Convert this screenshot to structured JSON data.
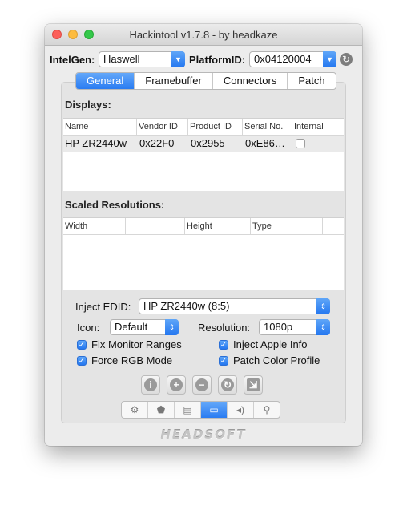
{
  "window": {
    "title": "Hackintool v1.7.8 - by headkaze"
  },
  "top": {
    "intelgen_label": "IntelGen:",
    "intelgen_value": "Haswell",
    "platformid_label": "PlatformID:",
    "platformid_value": "0x04120004"
  },
  "tabs": [
    "General",
    "Framebuffer",
    "Connectors",
    "Patch"
  ],
  "displays": {
    "heading": "Displays:",
    "columns": [
      "Name",
      "Vendor ID",
      "Product ID",
      "Serial No.",
      "Internal"
    ],
    "rows": [
      {
        "name": "HP ZR2440w",
        "vendor_id": "0x22F0",
        "product_id": "0x2955",
        "serial": "0xE86…",
        "internal": false
      }
    ]
  },
  "scaled": {
    "heading": "Scaled Resolutions:",
    "columns": [
      "Width",
      "",
      "Height",
      "Type"
    ]
  },
  "settings": {
    "inject_edid_label": "Inject EDID:",
    "inject_edid_value": "HP ZR2440w (8:5)",
    "icon_label": "Icon:",
    "icon_value": "Default",
    "resolution_label": "Resolution:",
    "resolution_value": "1080p",
    "fix_monitor_ranges": "Fix Monitor Ranges",
    "inject_apple_info": "Inject Apple Info",
    "force_rgb_mode": "Force RGB Mode",
    "patch_color_profile": "Patch Color Profile"
  },
  "actions": [
    "info-icon",
    "add-icon",
    "remove-icon",
    "refresh-icon",
    "export-icon"
  ],
  "bottom_toolbar": [
    "gear-icon",
    "shield-icon",
    "memory-icon",
    "display-icon",
    "speaker-icon",
    "usb-icon"
  ],
  "logo": "HEADSOFT",
  "colors": {
    "accent": "#2a7cf2"
  }
}
